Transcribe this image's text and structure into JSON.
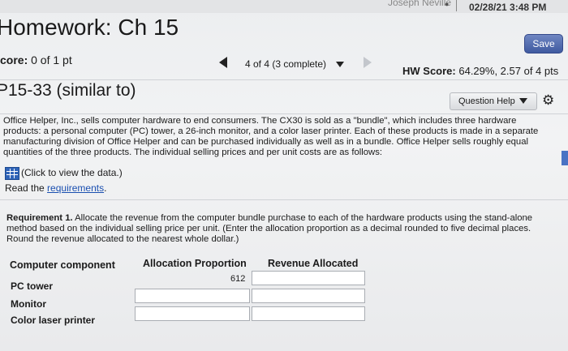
{
  "system_bar": {
    "user_name": "Joseph Neville",
    "datetime": "02/28/21 3:48 PM"
  },
  "header": {
    "title": "Homework: Ch 15",
    "save_label": "Save",
    "score_label": "core:",
    "score_value": "0 of 1 pt",
    "progress": "4 of 4 (3 complete)",
    "hw_score_label": "HW Score:",
    "hw_score_value": "64.29%, 2.57 of 4 pts"
  },
  "problem": {
    "id": "P15-33 (similar to)",
    "help_label": "Question Help",
    "text": "Office Helper, Inc., sells computer hardware to end consumers. The CX30 is sold as a \"bundle\", which includes three hardware products: a personal computer (PC) tower, a 26-inch monitor, and a color laser printer. Each of these products is made in a separate manufacturing division of Office Helper and can be purchased individually as well as in a bundle. Office Helper sells roughly equal quantities of the three products. The individual selling prices and per unit costs are as follows:",
    "data_link": "(Click to view the data.)",
    "read_prefix": "Read the",
    "requirements_link": "requirements",
    "read_suffix": "."
  },
  "requirement": {
    "label": "Requirement 1.",
    "text": "Allocate the revenue from the computer bundle purchase to each of the hardware products using the stand-alone method based on the individual selling price per unit. (Enter the allocation proportion as a decimal rounded to five decimal places. Round the revenue allocated to the nearest whole dollar.)"
  },
  "table": {
    "headers": [
      "Computer component",
      "Allocation Proportion",
      "Revenue Allocated"
    ],
    "rows": [
      {
        "component": "PC tower",
        "proportion": "612",
        "revenue": ""
      },
      {
        "component": "Monitor",
        "proportion": "",
        "revenue": ""
      },
      {
        "component": "Color laser printer",
        "proportion": "",
        "revenue": ""
      }
    ]
  },
  "icons": [
    "user-icon",
    "left-arrow-icon",
    "caret-down-icon",
    "right-arrow-icon",
    "gear-icon",
    "data-table-icon"
  ]
}
